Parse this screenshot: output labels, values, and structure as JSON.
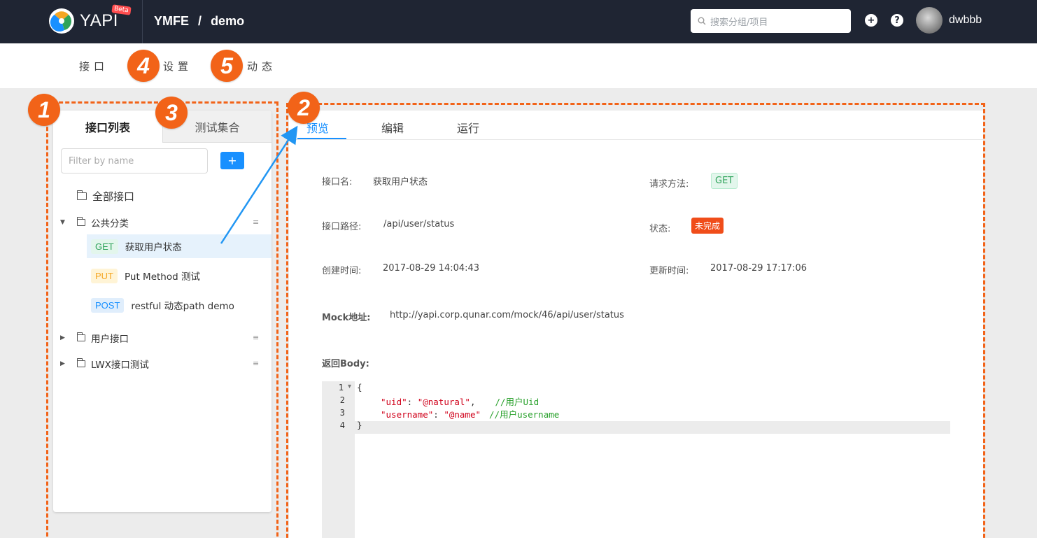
{
  "header": {
    "logo_text": "YAPI",
    "beta_label": "Beta",
    "breadcrumb": {
      "group": "YMFE",
      "separator": "/",
      "project": "demo"
    },
    "search_placeholder": "搜索分组/项目",
    "add_icon_glyph": "+",
    "help_icon_glyph": "?",
    "username": "dwbbb"
  },
  "subnav": {
    "items": [
      "接口",
      "设置",
      "动态"
    ]
  },
  "annotations": [
    "1",
    "2",
    "3",
    "4",
    "5"
  ],
  "left_panel": {
    "tabs": [
      "接口列表",
      "测试集合"
    ],
    "filter_placeholder": "Filter by name",
    "add_button": "+",
    "all_apis": "全部接口",
    "categories": [
      {
        "name": "公共分类",
        "expanded": true
      },
      {
        "name": "用户接口",
        "expanded": false
      },
      {
        "name": "LWX接口测试",
        "expanded": false
      }
    ],
    "apis": [
      {
        "method": "GET",
        "name": "获取用户状态",
        "selected": true,
        "color": "#2fa35a",
        "bg": "#e3f6ec"
      },
      {
        "method": "PUT",
        "name": "Put Method 测试",
        "selected": false,
        "color": "#f5a623",
        "bg": "#fff4d6"
      },
      {
        "method": "POST",
        "name": "restful 动态path demo",
        "selected": false,
        "color": "#1890ff",
        "bg": "#e0eefc"
      }
    ],
    "menu_glyph": "≡",
    "caret_expanded": "▼",
    "caret_collapsed": "▶"
  },
  "right_panel": {
    "tabs": [
      "预览",
      "编辑",
      "运行"
    ],
    "labels": {
      "name": "接口名:",
      "method": "请求方法:",
      "path": "接口路径:",
      "status": "状态:",
      "created": "创建时间:",
      "updated": "更新时间:",
      "mock": "Mock地址:",
      "body": "返回Body:"
    },
    "values": {
      "name": "获取用户状态",
      "method": "GET",
      "path": "/api/user/status",
      "status": "未完成",
      "created": "2017-08-29 14:04:43",
      "updated": "2017-08-29 17:17:06",
      "mock": "http://yapi.corp.qunar.com/mock/46/api/user/status"
    },
    "code": {
      "line_numbers": [
        "1",
        "2",
        "3",
        "4"
      ],
      "fold_marker": "▾",
      "line1": "{",
      "line2_key": "\"uid\"",
      "line2_colon": ": ",
      "line2_val": "\"@natural\"",
      "line2_comma": ",",
      "line2_comment": "//用户Uid",
      "line3_key": "\"username\"",
      "line3_colon": ": ",
      "line3_val": "\"@name\"",
      "line3_comment": "//用户username",
      "line4": "}"
    }
  },
  "colors": {
    "accent": "#f26318",
    "primary": "#1890ff",
    "header_bg": "#1f2533"
  }
}
